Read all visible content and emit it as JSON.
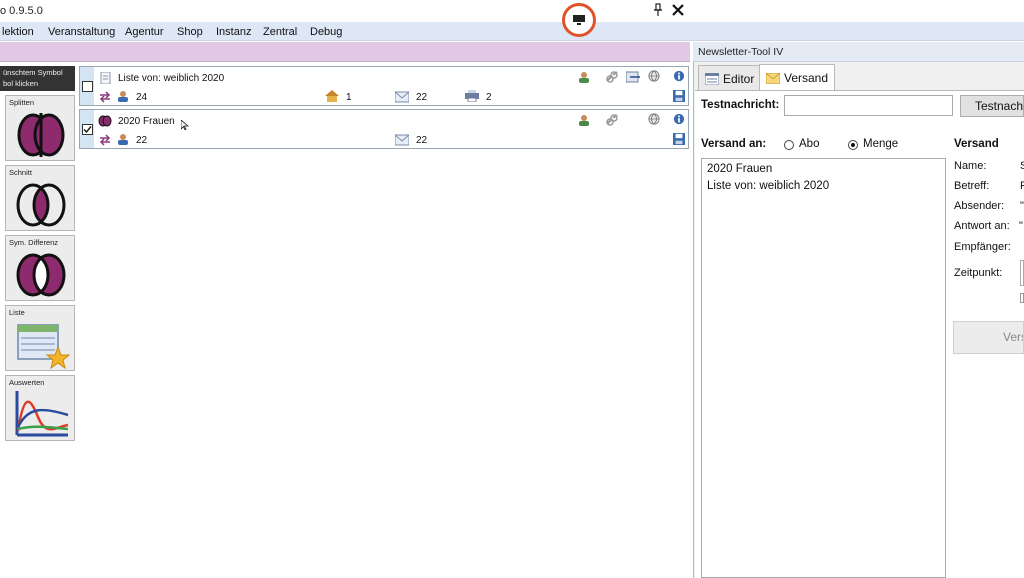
{
  "app": {
    "title": "o 0.9.5.0"
  },
  "menu": [
    "lektion",
    "Veranstaltung",
    "Agentur",
    "Shop",
    "Instanz",
    "Zentral",
    "Debug"
  ],
  "palette": {
    "hint": "ünschtem Symbol\nbol klicken",
    "tools": [
      {
        "label": "Splitten"
      },
      {
        "label": "Schnitt"
      },
      {
        "label": "Sym. Differenz"
      },
      {
        "label": "Liste"
      },
      {
        "label": "Auswerten"
      }
    ]
  },
  "lists": [
    {
      "name": "Liste von: weiblich 2020",
      "checked": false,
      "persons": "24",
      "houses": "1",
      "mails": "22",
      "extra": "2"
    },
    {
      "name": "2020 Frauen",
      "checked": true,
      "persons": "22",
      "mails": "22"
    }
  ],
  "panel": {
    "title": "Newsletter-Tool IV",
    "tabs": [
      {
        "label": "Editor"
      },
      {
        "label": "Versand"
      }
    ],
    "test_label": "Testnachricht:",
    "test_value": "",
    "test_button": "Testnachr",
    "versand_an_label": "Versand an:",
    "radio_abo": "Abo",
    "radio_menge": "Menge",
    "recipients": [
      "2020 Frauen",
      "Liste von: weiblich 2020"
    ],
    "info": {
      "heading": "Versand",
      "name_label": "Name:",
      "name_value": "S",
      "betreff_label": "Betreff:",
      "betreff_value": "F",
      "absender_label": "Absender:",
      "absender_value": "\"",
      "antwort_label": "Antwort an:",
      "antwort_value": "\"",
      "empfaenger_label": "Empfänger:",
      "zeitpunkt_label": "Zeitpunkt:"
    },
    "send_button": "Vers"
  }
}
